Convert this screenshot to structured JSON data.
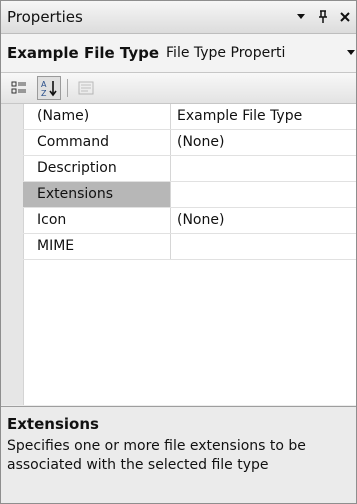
{
  "window": {
    "title": "Properties",
    "pin_icon": "pin-icon",
    "dropdown_icon": "dropdown-arrow-icon",
    "close_icon": "close-icon"
  },
  "selector": {
    "object_name": "Example File Type",
    "object_type": "File Type Properti",
    "dropdown_icon": "dropdown-arrow-icon"
  },
  "toolbar": {
    "categorized_icon": "categorized-view-icon",
    "alphabetical_icon": "alphabetical-sort-icon",
    "property_pages_icon": "property-pages-icon"
  },
  "grid": {
    "rows": [
      {
        "name": "(Name)",
        "value": "Example File Type"
      },
      {
        "name": "Command",
        "value": "(None)"
      },
      {
        "name": "Description",
        "value": ""
      },
      {
        "name": "Extensions",
        "value": ""
      },
      {
        "name": "Icon",
        "value": "(None)"
      },
      {
        "name": "MIME",
        "value": ""
      }
    ],
    "selected_row": "Extensions"
  },
  "description": {
    "title": "Extensions",
    "text": "Specifies one or more file extensions to be associated with the selected file type"
  },
  "colors": {
    "selected_row": "#b7b7b7",
    "panel_background": "#ececec"
  }
}
